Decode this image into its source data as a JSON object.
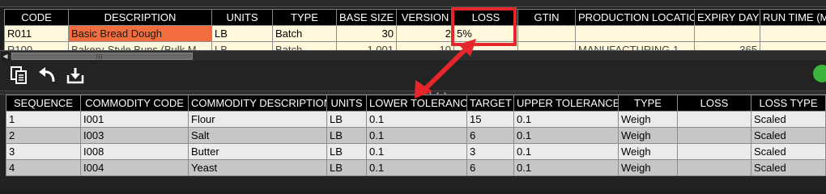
{
  "top_grid": {
    "columns": [
      "CODE",
      "DESCRIPTION",
      "UNITS",
      "TYPE",
      "BASE SIZE",
      "VERSION",
      "LOSS",
      "GTIN",
      "PRODUCTION LOCATION",
      "EXPIRY DAYS",
      "RUN TIME (MIN"
    ],
    "rows": [
      {
        "code": "R011",
        "description": "Basic Bread Dough",
        "units": "LB",
        "type": "Batch",
        "base_size": "30",
        "version": "2",
        "loss": "5%",
        "gtin": "",
        "production_location": "",
        "expiry_days": "",
        "run_time": ""
      },
      {
        "code": "R100",
        "description": "Bakery-Style Buns (Bulk M",
        "units": "LB",
        "type": "Batch",
        "base_size": "1,001",
        "version": "10",
        "loss": "",
        "gtin": "",
        "production_location": "MANUFACTURING 1",
        "expiry_days": "365",
        "run_time": ""
      }
    ],
    "highlight_color": "#f26d3d"
  },
  "toolbar": {
    "buttons": [
      "copy-icon",
      "undo-icon",
      "download-icon"
    ]
  },
  "bottom_grid": {
    "columns": [
      "SEQUENCE",
      "COMMODITY CODE",
      "COMMODITY DESCRIPTION",
      "UNITS",
      "LOWER TOLERANCE",
      "TARGET",
      "UPPER TOLERANCE",
      "TYPE",
      "LOSS",
      "LOSS TYPE"
    ],
    "rows": [
      {
        "sequence": "1",
        "code": "I001",
        "description": "Flour",
        "units": "LB",
        "lower": "0.1",
        "target": "15",
        "upper": "0.1",
        "type": "Weigh",
        "loss": "",
        "loss_type": "Scaled"
      },
      {
        "sequence": "2",
        "code": "I003",
        "description": "Salt",
        "units": "LB",
        "lower": "0.1",
        "target": "6",
        "upper": "0.1",
        "type": "Weigh",
        "loss": "",
        "loss_type": "Scaled"
      },
      {
        "sequence": "3",
        "code": "I008",
        "description": "Butter",
        "units": "LB",
        "lower": "0.1",
        "target": "3",
        "upper": "0.1",
        "type": "Weigh",
        "loss": "",
        "loss_type": "Scaled"
      },
      {
        "sequence": "4",
        "code": "I004",
        "description": "Yeast",
        "units": "LB",
        "lower": "0.1",
        "target": "6",
        "upper": "0.1",
        "type": "Weigh",
        "loss": "",
        "loss_type": "Scaled"
      }
    ]
  },
  "annotation": {
    "color": "#e5262d"
  }
}
